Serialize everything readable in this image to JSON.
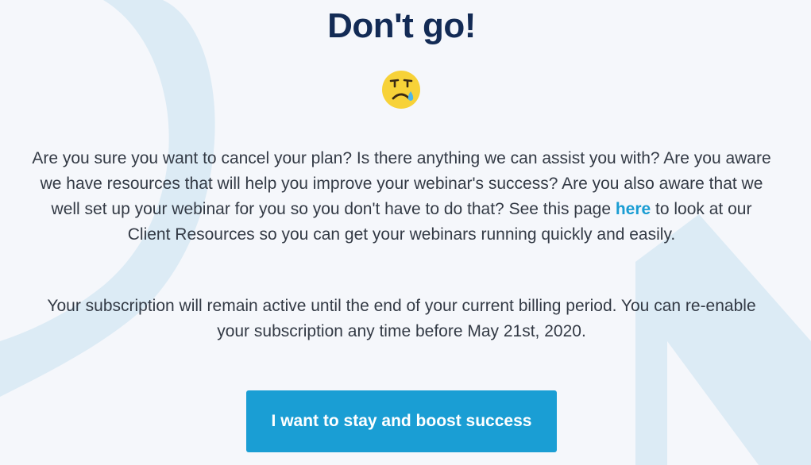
{
  "page": {
    "title": "Don't go!",
    "emoji_icon": "crying-face-icon"
  },
  "message": {
    "part1": "Are you sure you want to cancel your plan? Is there anything we can assist you with? Are you aware we have resources that will help you improve your webinar's success? Are you also aware that we well set up your webinar for you so you don't have to do that? See this page ",
    "link_label": "here",
    "part2": " to look at our Client Resources so you can get your webinars running quickly and easily."
  },
  "subscription_notice": "Your subscription will remain active until the end of your current billing period. You can re-enable your subscription any time before May 21st, 2020.",
  "cta": {
    "stay_label": "I want to stay and boost success"
  },
  "colors": {
    "background": "#f5f7fb",
    "title": "#132b55",
    "accent": "#1a9ed4",
    "decor": "#dcebf5"
  }
}
